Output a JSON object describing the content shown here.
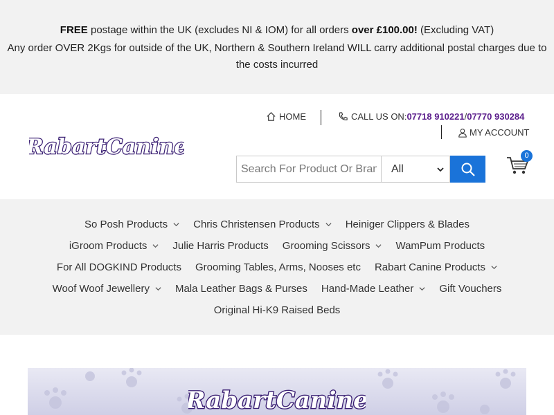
{
  "announcement": {
    "line1_strong1": "FREE",
    "line1_mid": " postage within the UK (excludes NI & IOM) for all orders ",
    "line1_strong2": "over £100.00!",
    "line1_end": " (Excluding VAT)",
    "line2": "Any order OVER 2Kgs for outside of the UK, Northern & Southern Ireland WILL carry additional postal charges due to the costs incurred"
  },
  "header": {
    "logo_text": "RabartCanine",
    "home_label": "HOME",
    "call_prefix": "CALL US ON: ",
    "phone1": "07718 910221",
    "phone_sep": " / ",
    "phone2": "07770 930284",
    "account_label": "MY ACCOUNT",
    "search_placeholder": "Search For Product Or Brand",
    "category_selected": "All",
    "cart_count": "0"
  },
  "nav": {
    "row1": [
      "So Posh Products",
      "Chris Christensen Products",
      "Heiniger Clippers & Blades"
    ],
    "row2": [
      "iGroom Products",
      "Julie Harris Products",
      "Grooming Scissors",
      "WamPum Products"
    ],
    "row3": [
      "For All DOGKIND Products",
      "Grooming Tables, Arms, Nooses etc",
      "Rabart Canine Products"
    ],
    "row4": [
      "Woof Woof Jewellery",
      "Mala Leather Bags & Purses",
      "Hand-Made Leather",
      "Gift Vouchers"
    ],
    "row5": [
      "Original Hi-K9 Raised Beds"
    ]
  },
  "banner": {
    "logo_text": "RabartCanine"
  },
  "colors": {
    "brand_purple": "#5b1e8c",
    "accent_blue": "#1a73d9",
    "bar_grey": "#f2f2f2"
  }
}
